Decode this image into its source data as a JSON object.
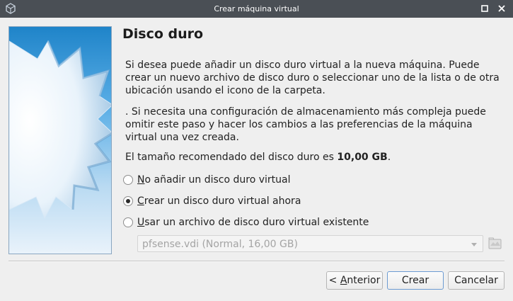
{
  "window": {
    "title": "Crear máquina virtual",
    "icons": [
      "virtualbox-icon",
      "maximize-icon",
      "close-icon"
    ]
  },
  "page": {
    "title": "Disco duro",
    "paragraph1": "Si desea puede añadir un disco duro virtual a la nueva máquina. Puede crear un nuevo archivo de disco duro o seleccionar uno de la lista o de otra ubicación usando el icono de la carpeta.",
    "paragraph2": ". Si necesita una configuración de almacenamiento más compleja puede omitir este paso y hacer los cambios a las preferencias de la máquina virtual una vez creada.",
    "recommended_prefix": "El tamaño recomendado del disco duro es ",
    "recommended_size": "10,00 GB",
    "recommended_suffix": "."
  },
  "options": [
    {
      "mnemonic": "N",
      "rest": "o añadir un disco duro virtual",
      "selected": false
    },
    {
      "mnemonic": "C",
      "rest": "rear un disco duro virtual ahora",
      "selected": true
    },
    {
      "mnemonic": "U",
      "rest": "sar un archivo de disco duro virtual existente",
      "selected": false
    }
  ],
  "disk_select": {
    "value": "pfsense.vdi (Normal, 16,00 GB)",
    "enabled": false
  },
  "buttons": {
    "back_prefix": "< ",
    "back_mnemonic": "A",
    "back_rest": "nterior",
    "create": "Crear",
    "cancel": "Cancelar"
  },
  "colors": {
    "titlebar": "#4a4f55",
    "banner_top": "#1f84c9",
    "banner_bottom": "#e6f1fa",
    "default_button_border": "#6c9bd2"
  }
}
